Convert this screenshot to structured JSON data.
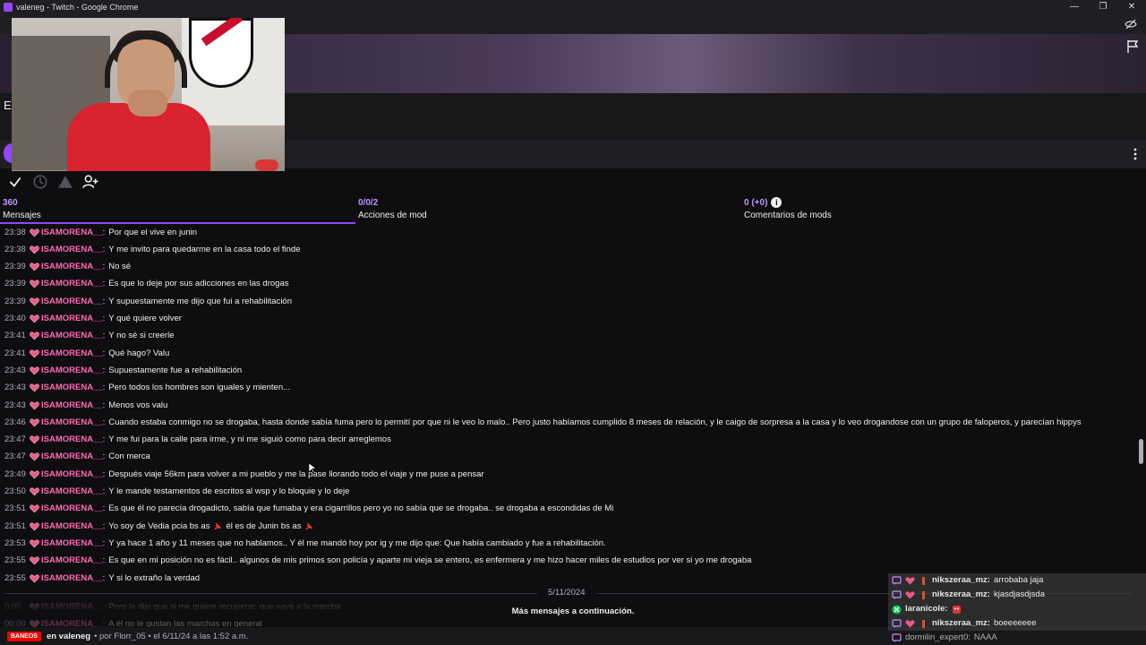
{
  "window": {
    "title": "valeneg - Twitch - Google Chrome",
    "controls": [
      "—",
      "❐",
      "✕"
    ]
  },
  "channel_partial_letter": "E",
  "mod_tabs": [
    {
      "count": "360",
      "label": "Mensajes"
    },
    {
      "count": "0/0/2",
      "label": "Acciones de mod"
    },
    {
      "count": "0 (+0)",
      "label": "Comentarios de mods"
    }
  ],
  "messages": [
    {
      "time": "23:38",
      "user": "ISAMORENA__",
      "text": "Por que el vive en junin"
    },
    {
      "time": "23:38",
      "user": "ISAMORENA__",
      "text": "Y me invito para quedarme en la casa todo el finde"
    },
    {
      "time": "23:39",
      "user": "ISAMORENA__",
      "text": "No sé"
    },
    {
      "time": "23:39",
      "user": "ISAMORENA__",
      "text": "Es que lo deje por sus adicciones en las drogas"
    },
    {
      "time": "23:39",
      "user": "ISAMORENA__",
      "text": "Y supuestamente me dijo que fui a rehabilitación"
    },
    {
      "time": "23:40",
      "user": "ISAMORENA__",
      "text": "Y qué quiere volver"
    },
    {
      "time": "23:41",
      "user": "ISAMORENA__",
      "text": "Y no sé si creerle"
    },
    {
      "time": "23:41",
      "user": "ISAMORENA__",
      "text": "Qué hago? Valu"
    },
    {
      "time": "23:43",
      "user": "ISAMORENA__",
      "text": "Supuestamente fue a rehabilitación"
    },
    {
      "time": "23:43",
      "user": "ISAMORENA__",
      "text": "Pero todos los hombres son iguales y mienten..."
    },
    {
      "time": "23:43",
      "user": "ISAMORENA__",
      "text": "Menos vos valu"
    },
    {
      "time": "23:46",
      "user": "ISAMORENA__",
      "text": "Cuando estaba conmigo no se drogaba, hasta donde sabía fuma pero lo permití por que ni le veo lo malo.. Pero justo habíamos cumplido 8 meses de relación, y le caigo de sorpresa a la casa y lo veo drogandose con un grupo de faloperos, y parecían hippys"
    },
    {
      "time": "23:47",
      "user": "ISAMORENA__",
      "text": "Y me fui para la calle para irme, y ni me siguió como para decir arreglemos"
    },
    {
      "time": "23:47",
      "user": "ISAMORENA__",
      "text": "Con merca"
    },
    {
      "time": "23:49",
      "user": "ISAMORENA__",
      "text": "Después viaje 56km para volver a mi pueblo y me la pase llorando todo el viaje y me puse a pensar"
    },
    {
      "time": "23:50",
      "user": "ISAMORENA__",
      "text": "Y le mande testamentos de escritos al wsp y lo bloquie y lo deje"
    },
    {
      "time": "23:51",
      "user": "ISAMORENA__",
      "text": "Es que él no parecía drogadicto, sabía que fumaba y era cigarrillos pero yo no sabía que se drogaba.. se drogaba a escondidas de Mi"
    },
    {
      "time": "23:51",
      "user": "ISAMORENA__",
      "text": "Yo soy de Vedia pcia bs as",
      "pin": true,
      "text2": "él es de Junin bs as",
      "pin2": true
    },
    {
      "time": "23:53",
      "user": "ISAMORENA__",
      "text": "Y ya hace 1 año y 11 meses que no hablamos.. Y él me mandó hoy por ig y me dijo que: Que había cambiado y fue a rehabilitación."
    },
    {
      "time": "23:55",
      "user": "ISAMORENA__",
      "text": "Es que en mi posición no es fácil.. algunos de mis primos son policía y aparte mi vieja se entero, es enfermera y me hizo hacer miles de estudios por ver si yo me drogaba"
    },
    {
      "time": "23:55",
      "user": "ISAMORENA__",
      "text": "Y si lo extraño la verdad"
    }
  ],
  "date_separator": "5/11/2024",
  "after_messages": [
    {
      "time": "0:00",
      "user": "ISAMORENA__",
      "text": "Pero le dije que si me quiere recuperar, que vaya a la marcha"
    },
    {
      "time": "00:00",
      "user": "ISAMORENA__",
      "text": "A él no le gustan las marchas en general"
    }
  ],
  "more_messages": "Más mensajes a continuación.",
  "bottom": {
    "badge": "BANEOS",
    "channel": "en valeneg",
    "meta": "• por Florr_05 • el 6/11/24 a las 1:52 a.m."
  },
  "overlay_chat": [
    {
      "user": "nikszeraa_mz:",
      "text": "arrobaba jaja",
      "boxed": true
    },
    {
      "user": "nikszeraa_mz:",
      "text": "kjasdjasdjsda",
      "boxed": true
    },
    {
      "user": "laranicole:",
      "text": "",
      "boxed": true
    },
    {
      "user": "nikszeraa_mz:",
      "text": "boeeeeeee",
      "boxed": true
    },
    {
      "user": "dormilin_expert0:",
      "text": "NAAA",
      "boxed": false
    }
  ],
  "colors": {
    "accent": "#9146ff",
    "username": "#ff69b4",
    "background": "#0e0e10"
  }
}
